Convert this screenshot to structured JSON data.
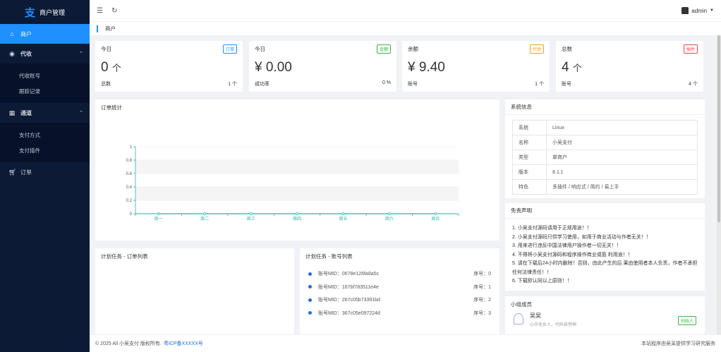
{
  "app": {
    "logo_glyph": "支",
    "title": "商户管理"
  },
  "sidebar": {
    "home": "商户",
    "groups": [
      {
        "label": "代收",
        "items": [
          "代收账号",
          "跟踪记录"
        ]
      },
      {
        "label": "通道",
        "items": [
          "支付方式",
          "支付插件"
        ]
      }
    ],
    "orders": "订单"
  },
  "header": {
    "user": "admin"
  },
  "breadcrumb": "商户",
  "stats": [
    {
      "title": "今日",
      "badge": "订单",
      "badge_color": "#1e90ff",
      "value": "0",
      "unit": "个",
      "foot_label": "总数",
      "foot_value": "1 个"
    },
    {
      "title": "今日",
      "badge": "金额",
      "badge_color": "#3bb54a",
      "value": "¥ 0.00",
      "unit": "",
      "foot_label": "成功率",
      "foot_value": "0 %"
    },
    {
      "title": "余额",
      "badge": "代收",
      "badge_color": "#f0a020",
      "value": "¥ 9.40",
      "unit": "",
      "foot_label": "账号",
      "foot_value": "1 个"
    },
    {
      "title": "总数",
      "badge": "插件",
      "badge_color": "#e5484d",
      "value": "4",
      "unit": "个",
      "foot_label": "账号",
      "foot_value": "4 个"
    }
  ],
  "chart_panel_title": "订单统计",
  "chart_data": {
    "type": "line",
    "categories": [
      "周一",
      "周二",
      "周三",
      "周四",
      "周五",
      "周六",
      "周日"
    ],
    "values": [
      0,
      0,
      0,
      0,
      0,
      0,
      0
    ],
    "yticks": [
      "0",
      "0.2",
      "0.4",
      "0.6",
      "0.8",
      "1"
    ],
    "ylim": [
      0,
      1
    ],
    "color": "#2bb3a8"
  },
  "system": {
    "title": "系统信息",
    "rows": [
      {
        "k": "系统",
        "v": "Linux"
      },
      {
        "k": "名称",
        "v": "小吴支付"
      },
      {
        "k": "类型",
        "v": "单商户"
      },
      {
        "k": "版本",
        "v": "8.1.1"
      },
      {
        "k": "特色",
        "v": "多插件 / 响应式 / 简约 / 易上手"
      }
    ]
  },
  "disclaimer": {
    "title": "免责声明",
    "lines": [
      "1. 小吴支付源码请用于正规用途！！",
      "2. 小吴支付源码只供学习使用，如用于商业活动与作者无关！！",
      "3. 用来进行违反中国法律用户操作者一切无关！！",
      "4. 不得将小吴支付源码和程序操作商业或盈 利用途！！",
      "5. 请在下载后24小时内删除！否则，由此产生的后 果由使用者本人负责，作者不承担任何法律责任！！",
      "6. 下载即认同以上原则！！"
    ]
  },
  "task_orders": {
    "title": "计划任务 - 订单列表"
  },
  "task_accounts": {
    "title": "计划任务 - 账号列表",
    "rows": [
      {
        "label": "账号MID：0678e126fa8a5c",
        "seq": "序号：0"
      },
      {
        "label": "账号MID：167bf783511e4e",
        "seq": "序号：1"
      },
      {
        "label": "账号MID：267c05b73391bd",
        "seq": "序号：2"
      },
      {
        "label": "账号MID：367c05e097224d",
        "seq": "序号：3"
      }
    ]
  },
  "members": {
    "title": "小组成员",
    "name": "吴吴",
    "desc": "心中无女人，代码自然神",
    "badge": "创始人"
  },
  "footer": {
    "copyright": "© 2025 All 小吴支付 版权所有.",
    "icp": "粤ICP备XXXXX号",
    "right": "本站程序由吴呆提供学习研究服务"
  }
}
